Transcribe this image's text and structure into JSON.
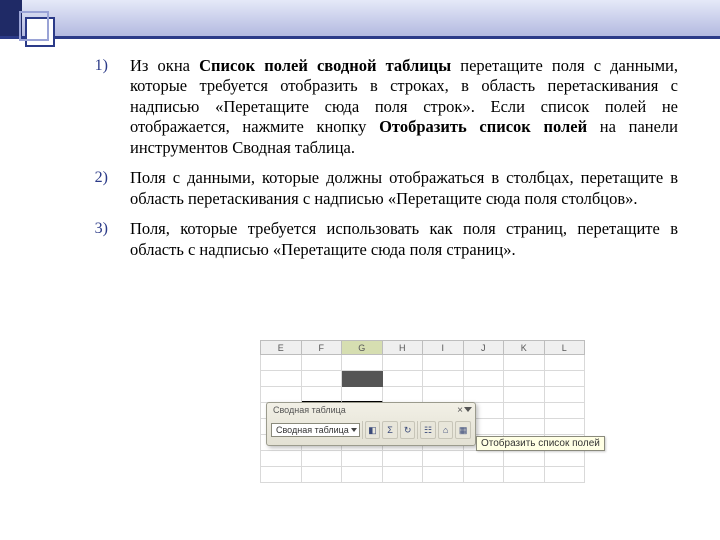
{
  "list": {
    "items": [
      {
        "pre": "Из окна ",
        "b1": "Список полей сводной таблицы",
        "mid": " перетащите поля с данными, которые требуется отобразить в строках, в область перетаскивания с надписью «Перетащите сюда поля строк». Если список полей не отображается, нажмите кнопку ",
        "b2": "Отобразить список полей",
        "post": "   на панели инструментов Сводная таблица."
      },
      {
        "text": "Поля с данными, которые должны отображаться в столбцах, перетащите в область перетаскивания с надписью «Перетащите сюда поля столбцов»."
      },
      {
        "text": "Поля, которые требуется использовать как поля страниц, перетащите в область с надписью «Перетащите сюда поля страниц»."
      }
    ]
  },
  "shot": {
    "columns": [
      "E",
      "F",
      "G",
      "H",
      "I",
      "J",
      "K",
      "L"
    ],
    "toolbar_title": "Сводная таблица",
    "combo_label": "Сводная таблица",
    "tooltip": "Отобразить список полей"
  }
}
